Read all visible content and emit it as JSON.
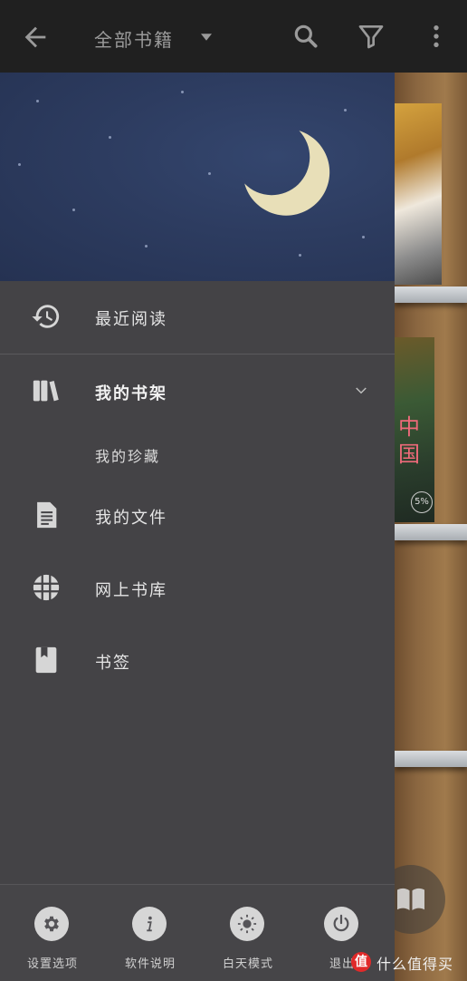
{
  "toolbar": {
    "back_icon": "arrow-left-icon",
    "title": "全部书籍",
    "dropdown_icon": "caret-down-icon",
    "actions": [
      "search-icon",
      "filter-icon",
      "more-vert-icon"
    ]
  },
  "shelf": {
    "book2_title": "中国",
    "book2_progress": "5%"
  },
  "drawer": {
    "menu": [
      {
        "label": "最近阅读",
        "icon": "history-icon"
      },
      {
        "label": "我的书架",
        "icon": "books-icon",
        "expanded": true
      },
      {
        "label": "我的珍藏",
        "sub": true
      },
      {
        "label": "我的文件",
        "icon": "document-icon"
      },
      {
        "label": "网上书库",
        "icon": "globe-grid-icon"
      },
      {
        "label": "书签",
        "icon": "bookmark-icon"
      }
    ],
    "bottom": [
      {
        "label": "设置选项",
        "icon": "gear-icon"
      },
      {
        "label": "软件说明",
        "icon": "info-icon"
      },
      {
        "label": "白天模式",
        "icon": "sun-icon"
      },
      {
        "label": "退出",
        "icon": "power-icon"
      }
    ]
  },
  "watermark": {
    "logo": "值",
    "text": "什么值得买"
  },
  "colors": {
    "drawer_bg": "#444346",
    "header_bg": "#2d3c60",
    "topbar_bg": "#202020",
    "moon": "#e8dfb8"
  }
}
